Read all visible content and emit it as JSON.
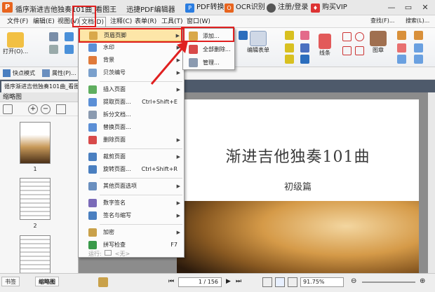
{
  "titlebar": {
    "title": "循序渐进吉他独奏101曲_看图王",
    "pdf_editor": "迅捷PDF编辑器",
    "pdf_convert": "PDF转换",
    "ocr": "OCR识别",
    "login": "注册/登录",
    "vip": "购买VIP"
  },
  "menubar": {
    "items": [
      "文件(F)",
      "编辑(E)",
      "视图(V)",
      "文档(D)",
      "注释(C)",
      "表单(R)",
      "工具(T)",
      "窗口(W)"
    ]
  },
  "ribbon": {
    "open_label": "打开(O)...",
    "edit_form_label": "编辑表单",
    "line_label": "线条",
    "stamp_label": "图章",
    "find_label": "查找(F)...",
    "search_label": "搜索(L)..."
  },
  "quickbar": {
    "snapshot_label": "快点模式",
    "properties_label": "属性(P)..."
  },
  "tabbar": {
    "doc_tab": "循序渐进吉他独奏101曲_看图王"
  },
  "thumbpane": {
    "title": "缩略图",
    "pages": [
      "1",
      "2"
    ]
  },
  "document": {
    "title": "渐进吉他独奏101曲",
    "subtitle": "初级篇"
  },
  "statusbar": {
    "bookmarks_tab": "书签",
    "thumbnails_tab": "缩略图",
    "page_indicator": "1 / 156",
    "zoom": "91.75%"
  },
  "doc_menu": {
    "items": [
      {
        "label": "页眉页脚",
        "shortcut": "",
        "submenu": true
      },
      {
        "label": "水印",
        "shortcut": "",
        "submenu": true
      },
      {
        "label": "背景",
        "shortcut": "",
        "submenu": true
      },
      {
        "label": "贝茨编号",
        "shortcut": "",
        "submenu": true
      },
      {
        "label": "插入页面",
        "shortcut": "",
        "submenu": true
      },
      {
        "label": "提取页面...",
        "shortcut": "Ctrl+Shift+E",
        "submenu": false
      },
      {
        "label": "拆分文档...",
        "shortcut": "",
        "submenu": false
      },
      {
        "label": "替换页面...",
        "shortcut": "",
        "submenu": false
      },
      {
        "label": "删除页面",
        "shortcut": "",
        "submenu": true
      },
      {
        "label": "裁剪页面",
        "shortcut": "",
        "submenu": true
      },
      {
        "label": "旋转页面...",
        "shortcut": "Ctrl+Shift+R",
        "submenu": false
      },
      {
        "label": "其他页面选项",
        "shortcut": "",
        "submenu": true
      },
      {
        "label": "数字签名",
        "shortcut": "",
        "submenu": true
      },
      {
        "label": "签名与缩写",
        "shortcut": "",
        "submenu": true
      },
      {
        "label": "加密",
        "shortcut": "",
        "submenu": true
      },
      {
        "label": "拼写检查",
        "shortcut": "F7",
        "submenu": false
      }
    ],
    "run_label": "运行:",
    "run_value": "<无>"
  },
  "sub_menu": {
    "items": [
      "添加...",
      "全部删除...",
      "管理..."
    ]
  },
  "colors": {
    "highlight": "#fde6a8",
    "annotation_red": "#e02020",
    "tab_bar": "#4e5a6b",
    "brand_orange": "#e8641e"
  }
}
